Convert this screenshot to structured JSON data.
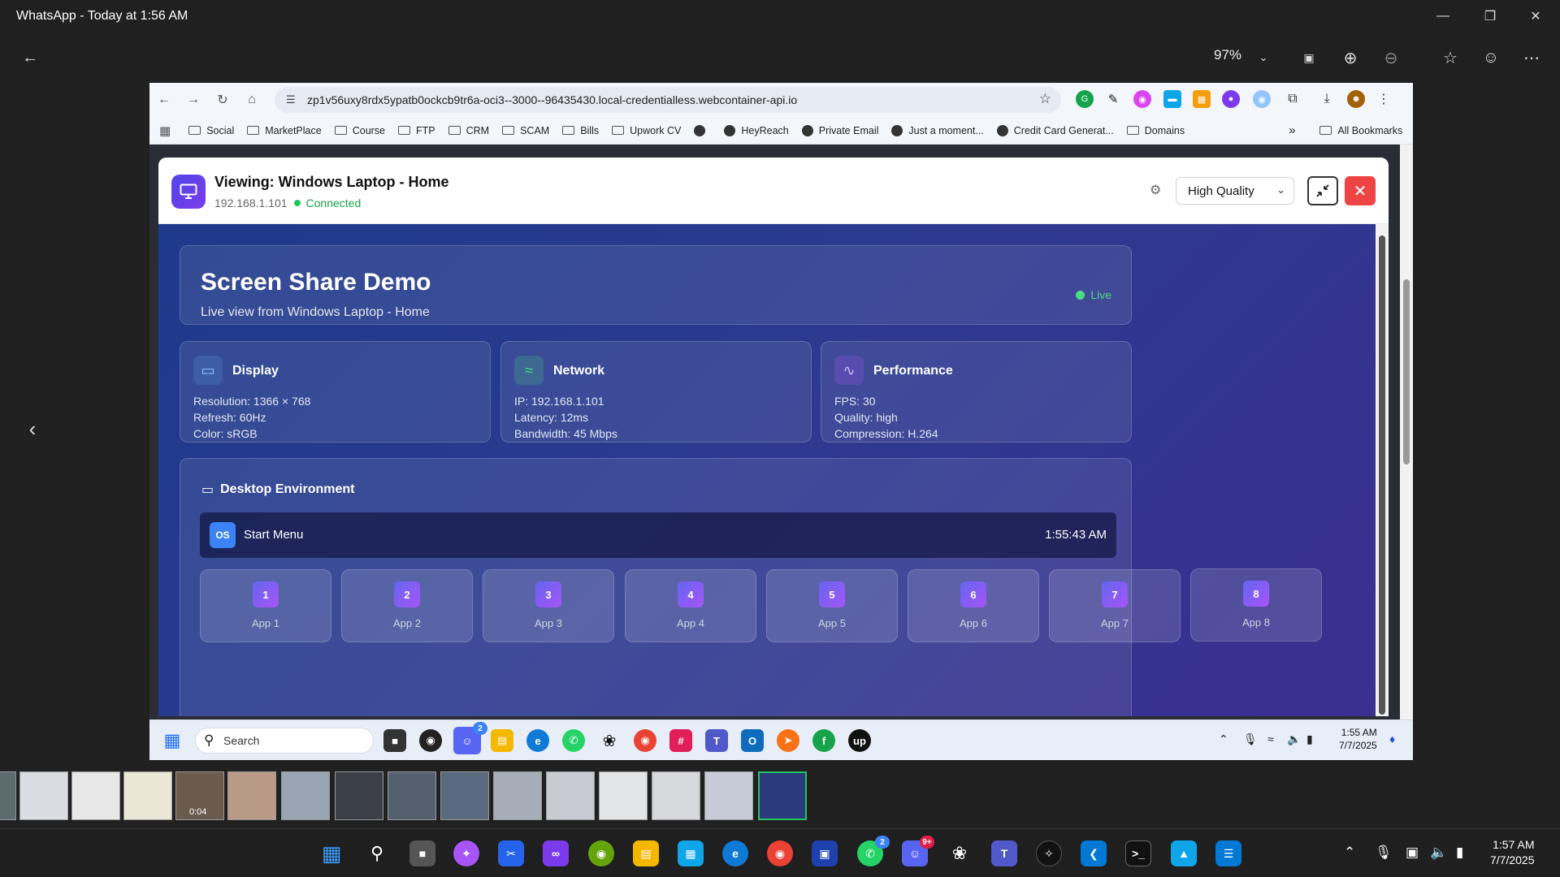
{
  "window": {
    "title": "WhatsApp - Today at 1:56 AM"
  },
  "viewer": {
    "zoom": "97%"
  },
  "browser": {
    "url": "zp1v56uxy8rdx5ypatb0ockcb9tr6a-oci3--3000--96435430.local-credentialless.webcontainer-api.io",
    "bookmarks": [
      "Social",
      "MarketPlace",
      "Course",
      "FTP",
      "CRM",
      "SCAM",
      "Bills",
      "Upwork CV",
      "HeyReach",
      "Private Email",
      "Just a moment...",
      "Credit Card Generat...",
      "Domains"
    ],
    "more_bookmarks": "»",
    "all_bookmarks": "All Bookmarks"
  },
  "modal": {
    "title": "Viewing: Windows Laptop - Home",
    "ip": "192.168.1.101",
    "status": "Connected",
    "quality": "High Quality"
  },
  "demo": {
    "title": "Screen Share Demo",
    "subtitle": "Live view from Windows Laptop - Home",
    "live": "Live"
  },
  "cards": [
    {
      "title": "Display",
      "lines": [
        "Resolution: 1366 × 768",
        "Refresh: 60Hz",
        "Color: sRGB"
      ]
    },
    {
      "title": "Network",
      "lines": [
        "IP: 192.168.1.101",
        "Latency: 12ms",
        "Bandwidth: 45 Mbps"
      ]
    },
    {
      "title": "Performance",
      "lines": [
        "FPS: 30",
        "Quality: high",
        "Compression: H.264"
      ]
    }
  ],
  "desktop": {
    "title": "Desktop Environment",
    "os_badge": "OS",
    "start_menu": "Start Menu",
    "clock": "1:55:43 AM",
    "apps": [
      {
        "num": "1",
        "label": "App 1"
      },
      {
        "num": "2",
        "label": "App 2"
      },
      {
        "num": "3",
        "label": "App 3"
      },
      {
        "num": "4",
        "label": "App 4"
      },
      {
        "num": "5",
        "label": "App 5"
      },
      {
        "num": "6",
        "label": "App 6"
      },
      {
        "num": "7",
        "label": "App 7"
      },
      {
        "num": "8",
        "label": "App 8"
      }
    ]
  },
  "inner_taskbar": {
    "search": "Search",
    "time": "1:55 AM",
    "date": "7/7/2025",
    "discord_badge": "2"
  },
  "filmstrip": {
    "video_duration": "0:04"
  },
  "taskbar": {
    "time": "1:57 AM",
    "date": "7/7/2025",
    "whatsapp_badge": "2",
    "discord_badge": "9+"
  }
}
